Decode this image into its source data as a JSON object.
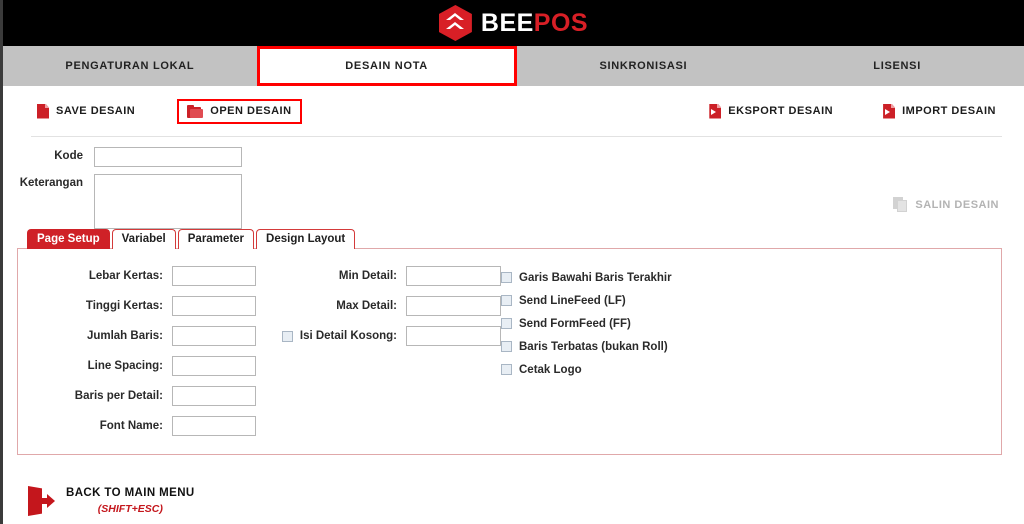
{
  "header": {
    "logo_bee": "BEE",
    "logo_pos": "POS",
    "logo_icon": "beepos-hexagon-logo",
    "bg_color": "#000000",
    "accent_color": "#d81f26"
  },
  "nav": {
    "items": [
      {
        "label": "PENGATURAN LOKAL",
        "active": false
      },
      {
        "label": "DESAIN NOTA",
        "active": true
      },
      {
        "label": "SINKRONISASI",
        "active": false
      },
      {
        "label": "LISENSI",
        "active": false
      }
    ],
    "bg_color": "#c2c2c2",
    "active_border_color": "#ff0000"
  },
  "toolbar": {
    "save_label": "SAVE DESAIN",
    "open_label": "OPEN DESAIN",
    "eksport_label": "EKSPORT DESAIN",
    "import_label": "IMPORT DESAIN",
    "save_icon": "document-icon",
    "open_icon": "folder-icon",
    "eksport_icon": "document-export-icon",
    "import_icon": "document-import-icon",
    "open_highlight_color": "#ff0000"
  },
  "form": {
    "kode_label": "Kode",
    "kode_value": "",
    "keterangan_label": "Keterangan",
    "keterangan_value": "",
    "salin_label": "SALIN DESAIN",
    "salin_icon": "copy-icon",
    "salin_disabled": true
  },
  "tabs": [
    {
      "label": "Page Setup",
      "active": true
    },
    {
      "label": "Variabel",
      "active": false
    },
    {
      "label": "Parameter",
      "active": false
    },
    {
      "label": "Design Layout",
      "active": false
    }
  ],
  "page_setup": {
    "left_fields": [
      {
        "label": "Lebar Kertas:",
        "value": ""
      },
      {
        "label": "Tinggi Kertas:",
        "value": ""
      },
      {
        "label": "Jumlah Baris:",
        "value": ""
      },
      {
        "label": "Line Spacing:",
        "value": ""
      },
      {
        "label": "Baris per Detail:",
        "value": ""
      },
      {
        "label": "Font Name:",
        "value": ""
      }
    ],
    "middle_fields": [
      {
        "label": "Min Detail:",
        "value": "",
        "has_checkbox": false,
        "checked": false
      },
      {
        "label": "Max Detail:",
        "value": "",
        "has_checkbox": false,
        "checked": false
      },
      {
        "label": "Isi Detail Kosong:",
        "value": "",
        "has_checkbox": true,
        "checked": false
      }
    ],
    "checkboxes": [
      {
        "label": "Garis Bawahi Baris Terakhir",
        "checked": false
      },
      {
        "label": "Send LineFeed (LF)",
        "checked": false
      },
      {
        "label": "Send FormFeed (FF)",
        "checked": false
      },
      {
        "label": "Baris Terbatas (bukan Roll)",
        "checked": false
      },
      {
        "label": "Cetak Logo",
        "checked": false
      }
    ]
  },
  "footer": {
    "main_label": "BACK TO MAIN MENU",
    "shortcut_label": "(SHIFT+ESC)",
    "icon": "exit-door-arrow-icon",
    "shortcut_color": "#c4161c"
  }
}
